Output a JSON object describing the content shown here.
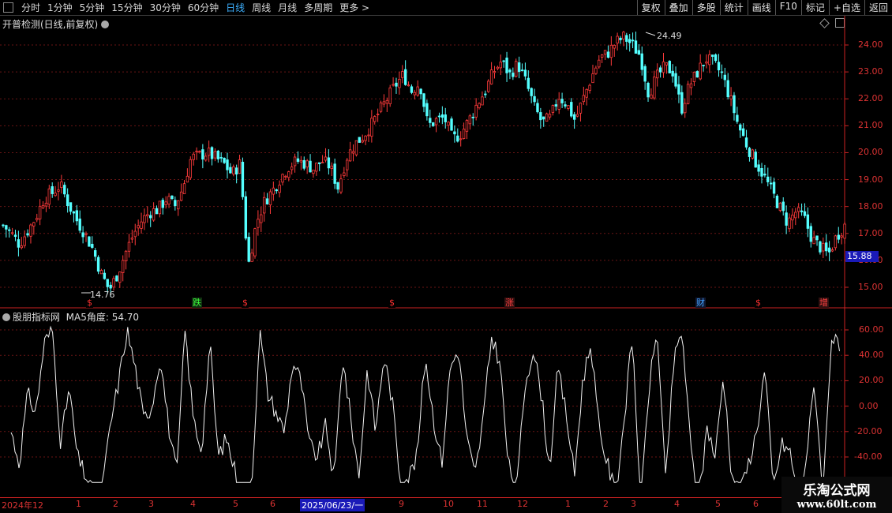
{
  "toolbar": {
    "periods": [
      "分时",
      "1分钟",
      "5分钟",
      "15分钟",
      "30分钟",
      "60分钟",
      "日线",
      "周线",
      "月线",
      "多周期",
      "更多 >"
    ],
    "active_period": "日线",
    "actions": [
      "复权",
      "叠加",
      "多股",
      "统计",
      "画线",
      "F10",
      "标记",
      "+自选",
      "返回"
    ]
  },
  "main_chart": {
    "title": "开普检测(日线,前复权)",
    "y_labels": [
      "24.00",
      "23.00",
      "22.00",
      "21.00",
      "20.00",
      "19.00",
      "18.00",
      "17.00",
      "16.00",
      "15.00"
    ],
    "current_price": "15.88",
    "high_note": "24.49",
    "low_note": "14.76",
    "markers": [
      {
        "text": "$",
        "color": "#ff3030",
        "bg": "#000"
      },
      {
        "text": "跌",
        "color": "#3cff3c",
        "bg": "#103010"
      },
      {
        "text": "$",
        "color": "#ff3030",
        "bg": "#000"
      },
      {
        "text": "$",
        "color": "#ff3030",
        "bg": "#000"
      },
      {
        "text": "涨",
        "color": "#ff4040",
        "bg": "#301010"
      },
      {
        "text": "财",
        "color": "#40a0ff",
        "bg": "#101830"
      },
      {
        "text": "$",
        "color": "#ff3030",
        "bg": "#000"
      },
      {
        "text": "增",
        "color": "#ff4040",
        "bg": "#301010"
      }
    ]
  },
  "sub_chart": {
    "title": "股朋指标网",
    "indicator_label": "MA5角度: 54.70",
    "y_labels": [
      "60.00",
      "40.00",
      "20.00",
      "0.00",
      "-20.00",
      "-40.00"
    ]
  },
  "date_axis": {
    "labels": [
      "2024年12",
      "1",
      "2",
      "3",
      "4",
      "5",
      "6",
      "2025/06/23/一",
      "9",
      "10",
      "11",
      "12",
      "1",
      "2",
      "3",
      "4",
      "5",
      "6"
    ]
  },
  "watermark": {
    "line1": "乐淘公式网",
    "line2": "www.60lt.com"
  },
  "chart_data": {
    "type": "candlestick",
    "price_range": [
      14.5,
      24.8
    ],
    "series_up_color": "#ff3b3b",
    "series_down_color": "#54ffff",
    "close_path": [
      17.3,
      17.0,
      16.6,
      17.1,
      17.6,
      18.3,
      18.5,
      18.8,
      18.1,
      17.5,
      17.0,
      16.4,
      15.5,
      14.9,
      15.5,
      16.3,
      17.0,
      17.5,
      17.8,
      17.9,
      18.3,
      18.0,
      18.7,
      19.8,
      19.9,
      20.0,
      19.8,
      19.6,
      19.2,
      19.6,
      15.8,
      17.4,
      18.2,
      18.6,
      19.1,
      19.5,
      19.7,
      19.6,
      19.4,
      19.7,
      19.5,
      18.7,
      19.8,
      20.3,
      20.6,
      21.0,
      21.5,
      22.0,
      22.5,
      22.9,
      22.3,
      22.6,
      21.0,
      21.2,
      21.3,
      20.5,
      20.7,
      21.2,
      21.8,
      22.3,
      23.0,
      23.4,
      22.9,
      23.3,
      22.6,
      21.7,
      21.1,
      21.3,
      22.1,
      21.8,
      21.2,
      22.0,
      22.8,
      23.5,
      23.7,
      24.1,
      24.3,
      24.0,
      23.6,
      22.2,
      22.8,
      23.2,
      23.0,
      21.6,
      22.5,
      23.0,
      23.5,
      23.3,
      22.9,
      22.0,
      21.0,
      20.3,
      19.7,
      19.2,
      18.6,
      18.0,
      17.4,
      17.8,
      17.6,
      16.8,
      16.5,
      16.2,
      16.9,
      17.3
    ],
    "indicator_path": [
      -20,
      -45,
      10,
      -5,
      50,
      60,
      -30,
      15,
      -40,
      -55,
      -70,
      -65,
      -15,
      20,
      60,
      30,
      -10,
      0,
      40,
      -15,
      -55,
      60,
      -10,
      -35,
      50,
      -40,
      -25,
      -50,
      -80,
      -70,
      60,
      10,
      -5,
      -20,
      35,
      20,
      -30,
      -40,
      -15,
      -60,
      40,
      -10,
      -55,
      30,
      -20,
      40,
      5,
      -60,
      -55,
      -40,
      40,
      -10,
      -45,
      30,
      45,
      -25,
      -55,
      -10,
      55,
      35,
      -45,
      -70,
      15,
      45,
      10,
      -50,
      30,
      -5,
      -55,
      20,
      50,
      -20,
      -45,
      -70,
      -10,
      55,
      -80,
      15,
      60,
      -60,
      35,
      60,
      -30,
      -80,
      -15,
      -40,
      25,
      -55,
      -70,
      -45,
      -20,
      30,
      -65,
      -30,
      -35,
      -75,
      -40,
      20,
      -70,
      55,
      45
    ],
    "ylim_indicator": [
      -60,
      70
    ]
  }
}
